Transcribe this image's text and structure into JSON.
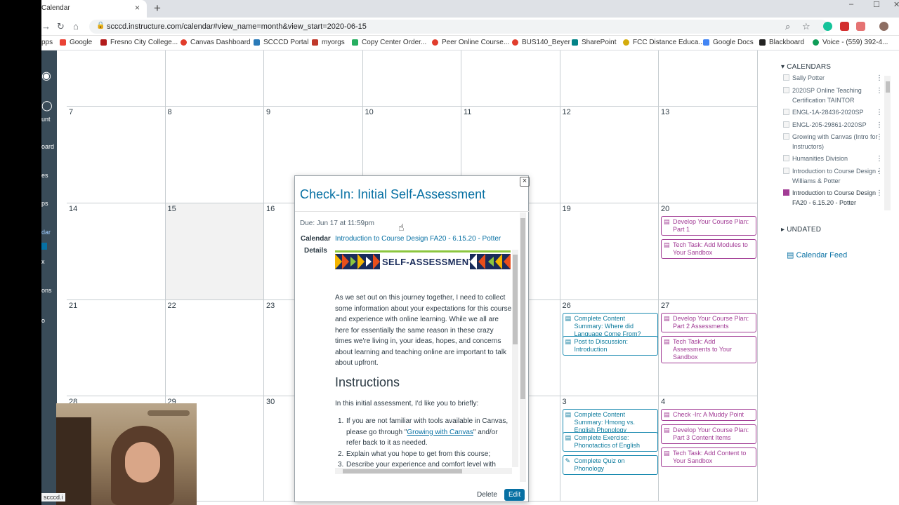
{
  "browser": {
    "tab_title": "Calendar",
    "tab_close": "×",
    "new_tab": "+",
    "url": "scccd.instructure.com/calendar#view_name=month&view_start=2020-06-15",
    "window_controls": [
      "–",
      "☐",
      "✕"
    ]
  },
  "bookmarks": [
    {
      "label": "pps",
      "color": "#4285f4"
    },
    {
      "label": "Google",
      "color": "#ea4335"
    },
    {
      "label": "Fresno City College...",
      "color": "#b31b1b"
    },
    {
      "label": "Canvas Dashboard",
      "color": "#e13d2d"
    },
    {
      "label": "SCCCD Portal",
      "color": "#2a7ab8"
    },
    {
      "label": "myorgs",
      "color": "#c0392b"
    },
    {
      "label": "Copy Center Order...",
      "color": "#27ae60"
    },
    {
      "label": "Peer Online Course...",
      "color": "#e13d2d"
    },
    {
      "label": "BUS140_Beyer",
      "color": "#e13d2d"
    },
    {
      "label": "SharePoint",
      "color": "#038387"
    },
    {
      "label": "FCC Distance Educa...",
      "color": "#d4ac0d"
    },
    {
      "label": "Google Docs",
      "color": "#4285f4"
    },
    {
      "label": "Blackboard",
      "color": "#222222"
    },
    {
      "label": "Voice - (559) 392-4...",
      "color": "#0f9d58"
    }
  ],
  "leftnav": {
    "items": [
      "unt",
      "oard",
      "es",
      "ps",
      "dar",
      "x",
      "ons",
      "o"
    ]
  },
  "calendar": {
    "rows": [
      {
        "days": [
          "",
          "",
          "",
          "",
          "",
          "",
          ""
        ]
      },
      {
        "days": [
          "7",
          "8",
          "9",
          "10",
          "11",
          "12",
          "13"
        ]
      },
      {
        "days": [
          "14",
          "15",
          "16",
          "",
          "",
          "19",
          "20"
        ]
      },
      {
        "days": [
          "21",
          "22",
          "23",
          "",
          "",
          "26",
          "27"
        ]
      },
      {
        "days": [
          "28",
          "29",
          "30",
          "",
          "",
          "3",
          "4"
        ]
      }
    ],
    "events": {
      "d20": [
        "Develop Your Course Plan: Part 1",
        "Tech Task: Add Modules to Your Sandbox"
      ],
      "d26": [
        "Complete Content Summary: Where did Language Come From?",
        "Post to Discussion: Introduction"
      ],
      "d27": [
        "Develop Your Course Plan: Part 2 Assessments",
        "Tech Task: Add Assessments to Your Sandbox"
      ],
      "d3": [
        "Complete Content Summary: Hmong vs. English Phonology",
        "Complete Exercise: Phonotactics of English",
        "Complete Quiz on Phonology"
      ],
      "d4": [
        "Check -In: A Muddy Point",
        "Develop Your Course Plan: Part 3 Content Items",
        "Tech Task: Add Content to Your Sandbox"
      ]
    }
  },
  "sidebar": {
    "calendars_heading": "CALENDARS",
    "calendars": [
      {
        "label": "Sally Potter",
        "color": "#f5f5f5"
      },
      {
        "label": "2020SP Online Teaching Certification TAINTOR",
        "color": "#f5f5f5"
      },
      {
        "label": "ENGL-1A-28436-2020SP",
        "color": "#f5f5f5"
      },
      {
        "label": "ENGL-205-29861-2020SP",
        "color": "#f5f5f5"
      },
      {
        "label": "Growing with Canvas (Intro for Instructors)",
        "color": "#f5f5f5"
      },
      {
        "label": "Humanities Division",
        "color": "#f5f5f5"
      },
      {
        "label": "Introduction to Course Design - Williams & Potter",
        "color": "#f5f5f5"
      },
      {
        "label": "Introduction to Course Design FA20 - 6.15.20 - Potter",
        "color": "#a23c95"
      }
    ],
    "menu_glyph": "⋮",
    "undated_heading": "UNDATED",
    "calendar_feed": "Calendar Feed"
  },
  "popup": {
    "title": "Check-In: Initial Self-Assessment",
    "due": "Due: Jun 17 at 11:59pm",
    "calendar_label": "Calendar",
    "details_label": "Details",
    "calendar_link": "Introduction to Course Design FA20 - 6.15.20 - Potter",
    "banner_text": "SELF-ASSESSMENT",
    "paragraph": "As we set out on this journey together, I need to collect some information about your expectations for this course and experience with online learning. While we all are here for essentially the same reason in these crazy times we're living in, your ideas, hopes, and concerns about learning and teaching online are important to talk about upfront.",
    "instructions_heading": "Instructions",
    "intro": "In this initial assessment, I'd like you to briefly:",
    "list": {
      "item1_before": "If you are not familiar with tools available in Canvas, please go through \"",
      "item1_link": "Growing with Canvas",
      "item1_after": "\" and/or refer back to it as needed.",
      "item2": "Explain what you hope to get from this course;",
      "item3": "Describe your experience and comfort level with"
    },
    "delete_label": "Delete",
    "edit_label": "Edit",
    "close_glyph": "×"
  },
  "status_url": "scccd.i",
  "colors": {
    "link": "#0770a3",
    "course_purple": "#a23c95",
    "nav": "#394b58"
  }
}
